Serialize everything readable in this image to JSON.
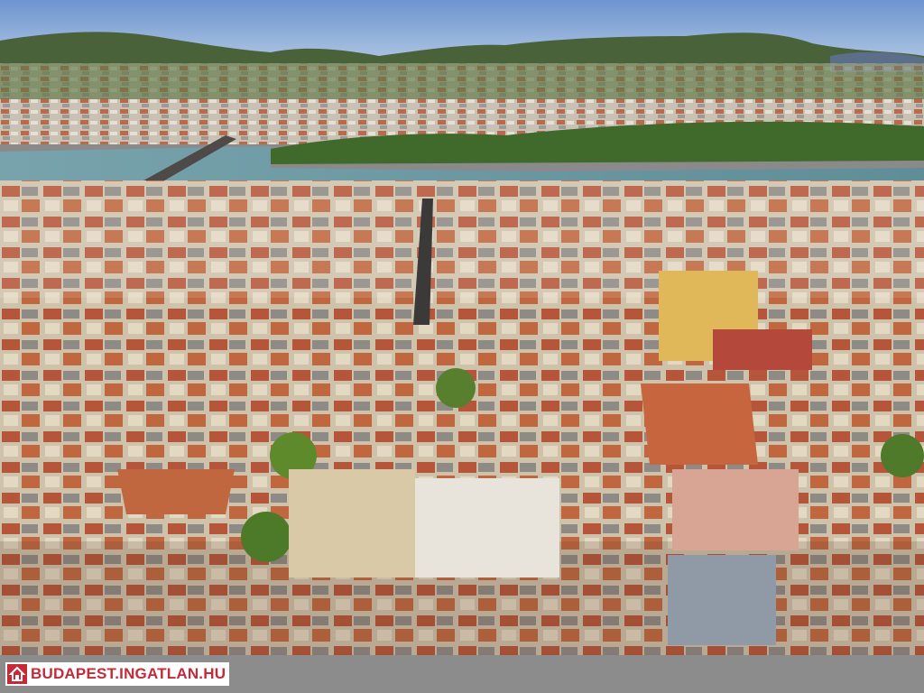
{
  "photo": {
    "subject": "aerial-city-view",
    "colors": {
      "sky": "#7fa6d8",
      "hills": "#4f6a3c",
      "river": "#6f99a3",
      "roof_red": "#b5563a",
      "facade_cream": "#d9c9a6"
    }
  },
  "watermark": {
    "text": "BUDAPEST.INGATLAN.HU",
    "icon": "house-logo-icon",
    "color": "#c62a38",
    "background": "#ffffff"
  },
  "footer": {
    "background": "#8c8c8c"
  }
}
